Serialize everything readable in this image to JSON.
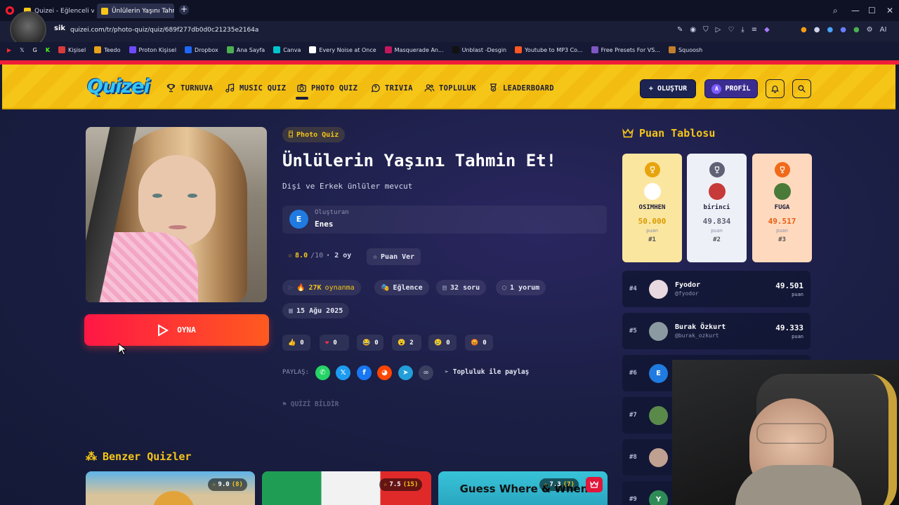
{
  "browser": {
    "tabs": [
      {
        "label": "Quizei - Eğlenceli ve etkileşimli quizler"
      },
      {
        "label": "Ünlülerin Yaşını Tahmin Et!"
      }
    ],
    "profile_label": "sik",
    "url": "quizei.com/tr/photo-quiz/quiz/689f277db0d0c21235e2164a",
    "bookmarks": [
      "Kişisel",
      "Teedo",
      "Proton Kişisel",
      "Dropbox",
      "Ana Sayfa",
      "Canva",
      "Every Noise at Once",
      "Masquerade An...",
      "Unblast -Desgin",
      "Youtube to MP3 Co...",
      "Free Presets For VS...",
      "Squoosh"
    ],
    "bookmark_colors": [
      "#d93a3a",
      "#e8a11a",
      "#6d4aff",
      "#1e66f5",
      "#4caf50",
      "#00c4cc",
      "#ffffff",
      "#c2185b",
      "#111111",
      "#ff5722",
      "#7e57c2",
      "#c27e2a"
    ]
  },
  "header": {
    "logo": "Quizei",
    "nav": [
      {
        "label": "TURNUVA",
        "icon": "trophy-icon"
      },
      {
        "label": "MUSIC QUIZ",
        "icon": "music-icon"
      },
      {
        "label": "PHOTO QUIZ",
        "icon": "camera-icon"
      },
      {
        "label": "TRIVIA",
        "icon": "question-icon"
      },
      {
        "label": "TOPLULUK",
        "icon": "users-icon"
      },
      {
        "label": "LEADERBOARD",
        "icon": "award-icon"
      }
    ],
    "create_label": "+ OLUŞTUR",
    "profile_label": "PROFİL",
    "profile_initial": "A"
  },
  "quiz": {
    "category": "Photo Quiz",
    "title": "Ünlülerin Yaşını Tahmin Et!",
    "subtitle": "Dişi ve Erkek ünlüler mevcut",
    "creator_label": "Oluşturan",
    "creator_name": "Enes",
    "creator_initial": "E",
    "rating": "8.0",
    "rating_max": "/10",
    "votes": "· 2 oy",
    "rate_label": "Puan Ver",
    "plays": "27K",
    "plays_label": "oynanma",
    "topic": "Eğlence",
    "questions": "32 soru",
    "comments": "1 yorum",
    "date": "15 Ağu 2025",
    "play_label": "OYNA",
    "reactions": [
      {
        "emoji": "👍",
        "count": "0"
      },
      {
        "emoji": "❤",
        "count": "0"
      },
      {
        "emoji": "😂",
        "count": "0"
      },
      {
        "emoji": "😮",
        "count": "2"
      },
      {
        "emoji": "😢",
        "count": "0"
      },
      {
        "emoji": "😡",
        "count": "0"
      }
    ],
    "share_label": "PAYLAŞ:",
    "community_share": "Topluluk ile paylaş",
    "report_label": "QUİZİ BİLDİR"
  },
  "leaderboard": {
    "title": "Puan Tablosu",
    "top3": [
      {
        "name": "OSIMHEN",
        "score": "50.000",
        "unit": "puan",
        "rank": "#1",
        "color": "#e8a40c"
      },
      {
        "name": "birinci",
        "score": "49.834",
        "unit": "puan",
        "rank": "#2",
        "color": "#5f6275"
      },
      {
        "name": "FUGA",
        "score": "49.517",
        "unit": "puan",
        "rank": "#3",
        "color": "#f06a1a"
      }
    ],
    "rows": [
      {
        "rank": "#4",
        "name": "Fyodor",
        "handle": "@fyodor",
        "score": "49.501",
        "unit": "puan"
      },
      {
        "rank": "#5",
        "name": "Burak Özkurt",
        "handle": "@burak_ozkurt",
        "score": "49.333",
        "unit": "puan"
      },
      {
        "rank": "#6",
        "initial": "E"
      },
      {
        "rank": "#7"
      },
      {
        "rank": "#8"
      },
      {
        "rank": "#9",
        "initial": "Y"
      }
    ]
  },
  "similar": {
    "title": "Benzer Quizler",
    "cards": [
      {
        "rating": "9.0",
        "count": "(8)"
      },
      {
        "rating": "7.5",
        "count": "(15)"
      },
      {
        "rating": "7.3",
        "count": "(7)",
        "overlay": "Guess Where & When"
      }
    ]
  }
}
